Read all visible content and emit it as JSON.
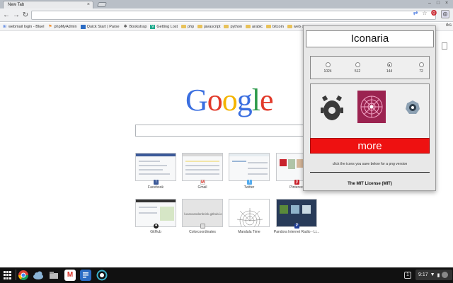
{
  "tab": {
    "title": "New Tab",
    "close": "×"
  },
  "window_controls": {
    "minimize": "–",
    "maximize": "□",
    "close": "×"
  },
  "toolbar": {
    "back": "←",
    "forward": "→",
    "reload": "↻",
    "omnibox_value": ""
  },
  "bookmarks": [
    {
      "label": "webmail login - Bluel",
      "icon": "apps-icon"
    },
    {
      "label": "phpMyAdmin",
      "icon": "php-icon"
    },
    {
      "label": "Quick Start | Parse",
      "icon": "parse-icon"
    },
    {
      "label": "Bookstrap",
      "icon": "gear-icon"
    },
    {
      "label": "Getting Lost",
      "icon": "vine-icon"
    },
    {
      "label": "php",
      "icon": "folder-icon"
    },
    {
      "label": "javascript",
      "icon": "folder-icon"
    },
    {
      "label": "python",
      "icon": "folder-icon"
    },
    {
      "label": "arabic",
      "icon": "folder-icon"
    },
    {
      "label": "bitcoin",
      "icon": "folder-icon"
    },
    {
      "label": "web dev",
      "icon": "folder-icon"
    }
  ],
  "bookmarks_more": "rks",
  "google": {
    "logo": [
      "G",
      "o",
      "o",
      "g",
      "l",
      "e"
    ],
    "search_value": ""
  },
  "tiles": [
    {
      "label": "Facebook"
    },
    {
      "label": "Gmail"
    },
    {
      "label": "Twitter"
    },
    {
      "label": "Pinterest"
    },
    {
      "label": "GitHub"
    },
    {
      "label": "Colorcoordinates"
    },
    {
      "label": "Mandala Time"
    },
    {
      "label": "Pandora Internet Radio - Li..."
    }
  ],
  "tile_thumb_text": {
    "colorcoordinates": "lucasvandenbrink.github.io"
  },
  "popup": {
    "title": "Iconaria",
    "sizes": [
      {
        "label": "1024",
        "checked": false
      },
      {
        "label": "512",
        "checked": false
      },
      {
        "label": "144",
        "checked": true
      },
      {
        "label": "72",
        "checked": false
      }
    ],
    "more_label": "more",
    "hint": "click the icons you save below for a png version",
    "license": "The MIT License (MIT)"
  },
  "shelf": {
    "notification_count": "1",
    "clock": "9:17"
  },
  "colors": {
    "more_button": "#ee1111",
    "google_blue": "#3b6fe0",
    "google_red": "#e23a2a",
    "google_yellow": "#f4b400",
    "google_green": "#2e9b4c"
  }
}
